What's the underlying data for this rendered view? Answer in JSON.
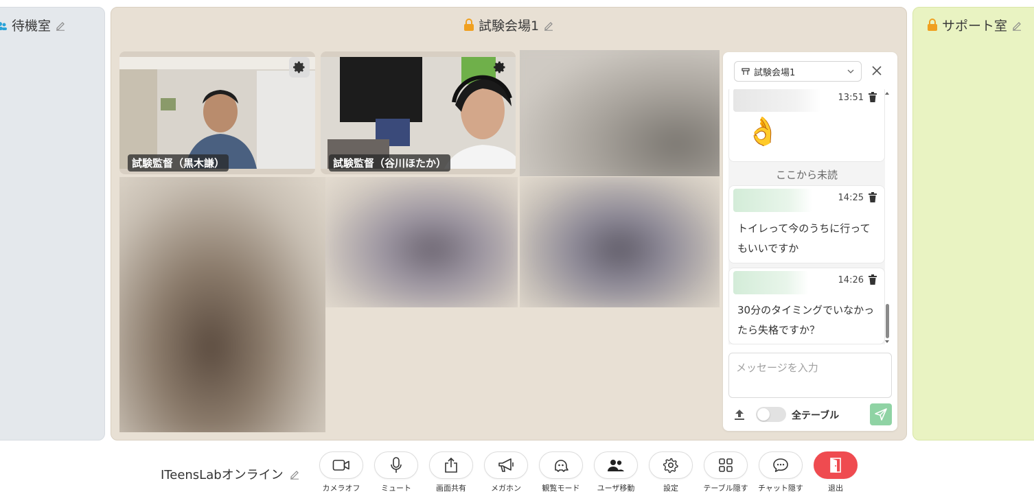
{
  "rooms": {
    "waiting": {
      "title": "待機室"
    },
    "exam": {
      "title": "試験会場1"
    },
    "support": {
      "title": "サポート室"
    }
  },
  "cameras": [
    {
      "label": "試験監督（黒木謙）"
    },
    {
      "label": "試験監督（谷川ほたか）"
    }
  ],
  "chat": {
    "room_select": "試験会場1",
    "messages": [
      {
        "time": "13:51",
        "text": "👌"
      },
      {
        "time": "14:25",
        "text": "トイレって今のうちに行ってもいいですか"
      },
      {
        "time": "14:26",
        "text": "30分のタイミングでいなかったら失格ですか？"
      }
    ],
    "unread_divider": "ここから未読",
    "input_placeholder": "メッセージを入力",
    "all_tables_label": "全テーブル"
  },
  "toolbar": {
    "space_name": "ITeensLabオンライン",
    "buttons": [
      {
        "label": "カメラオフ",
        "icon": "video-camera-icon"
      },
      {
        "label": "ミュート",
        "icon": "microphone-icon"
      },
      {
        "label": "画面共有",
        "icon": "share-screen-icon"
      },
      {
        "label": "メガホン",
        "icon": "megaphone-icon"
      },
      {
        "label": "観覧モード",
        "icon": "ghost-icon"
      },
      {
        "label": "ユーザ移動",
        "icon": "users-icon"
      },
      {
        "label": "設定",
        "icon": "gear-icon"
      },
      {
        "label": "テーブル隠す",
        "icon": "grid-icon"
      },
      {
        "label": "チャット隠す",
        "icon": "chat-bubble-icon"
      },
      {
        "label": "退出",
        "icon": "exit-door-icon"
      }
    ]
  },
  "colors": {
    "waiting_room_bg": "#e4e8ec",
    "exam_room_bg": "#e8e0d4",
    "support_room_bg": "#e9f3c2",
    "lock": "#f0a020",
    "send_button": "#8fd3a4",
    "exit_button": "#ef4b50"
  }
}
